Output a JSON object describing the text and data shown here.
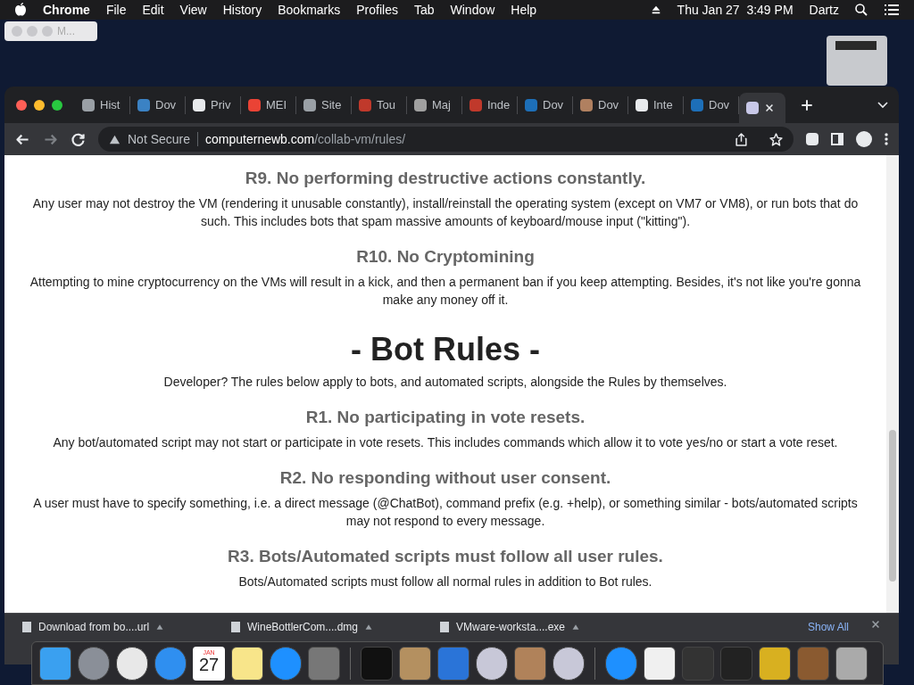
{
  "menu_bar": {
    "app": "Chrome",
    "menus": [
      "File",
      "Edit",
      "View",
      "History",
      "Bookmarks",
      "Profiles",
      "Tab",
      "Window",
      "Help"
    ],
    "clock": "Thu Jan 27  3:49 PM",
    "user": "Dartz"
  },
  "ghost_window": {
    "title": "M..."
  },
  "tabs": [
    {
      "label": "Hist",
      "selected": false
    },
    {
      "label": "Dov",
      "selected": false
    },
    {
      "label": "Priv",
      "selected": false
    },
    {
      "label": "MEI",
      "selected": false
    },
    {
      "label": "Site",
      "selected": false
    },
    {
      "label": "Tou",
      "selected": false
    },
    {
      "label": "Maj",
      "selected": false
    },
    {
      "label": "Inde",
      "selected": false
    },
    {
      "label": "Dov",
      "selected": false
    },
    {
      "label": "Dov",
      "selected": false
    },
    {
      "label": "Inte",
      "selected": false
    },
    {
      "label": "Dov",
      "selected": false
    },
    {
      "selected": true
    }
  ],
  "address_bar": {
    "security": "Not Secure",
    "domain": "computernewb.com",
    "path": "/collab-vm/rules/"
  },
  "content": [
    {
      "kind": "rule",
      "title": "R9. No performing destructive actions constantly.",
      "body": "Any user may not destroy the VM (rendering it unusable constantly), install/reinstall the operating system (except on VM7 or VM8), or run bots that do such. This includes bots that spam massive amounts of keyboard/mouse input (\"kitting\")."
    },
    {
      "kind": "rule",
      "title": "R10. No Cryptomining",
      "body": "Attempting to mine cryptocurrency on the VMs will result in a kick, and then a permanent ban if you keep attempting. Besides, it's not like you're gonna make any money off it."
    },
    {
      "kind": "section",
      "title": "- Bot Rules -",
      "body": "Developer? The rules below apply to bots, and automated scripts, alongside the Rules by themselves."
    },
    {
      "kind": "rule",
      "title": "R1. No participating in vote resets.",
      "body": "Any bot/automated script may not start or participate in vote resets. This includes commands which allow it to vote yes/no or start a vote reset."
    },
    {
      "kind": "rule",
      "title": "R2. No responding without user consent.",
      "body": "A user must have to specify something, i.e. a direct message (@ChatBot), command prefix (e.g. +help), or something similar - bots/automated scripts may not respond to every message."
    },
    {
      "kind": "rule",
      "title": "R3. Bots/Automated scripts must follow all user rules.",
      "body": "Bots/Automated scripts must follow all normal rules in addition to Bot rules."
    }
  ],
  "downloads": {
    "items": [
      "Download from bo....url",
      "WineBottlerCom....dmg",
      "VMware-worksta....exe"
    ],
    "show_all": "Show All"
  },
  "dock": {
    "calendar_month": "JAN",
    "calendar_day": "27"
  }
}
